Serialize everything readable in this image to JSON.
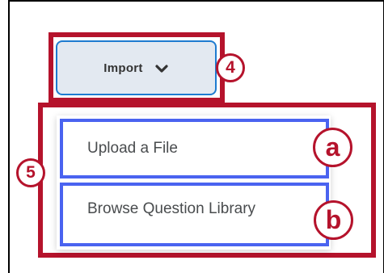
{
  "import_button": {
    "label": "Import",
    "icon": "chevron-down-icon"
  },
  "import_menu": {
    "items": [
      {
        "label": "Upload a File"
      },
      {
        "label": "Browse Question Library"
      }
    ]
  },
  "callouts": {
    "import": "4",
    "menu": "5",
    "upload": "a",
    "browse": "b",
    "color": "#b5132c"
  },
  "colors": {
    "button_background": "#e3e9f1",
    "button_border": "#1e7bd0",
    "item_highlight": "#4a63f0",
    "item_text": "#494c4e"
  }
}
